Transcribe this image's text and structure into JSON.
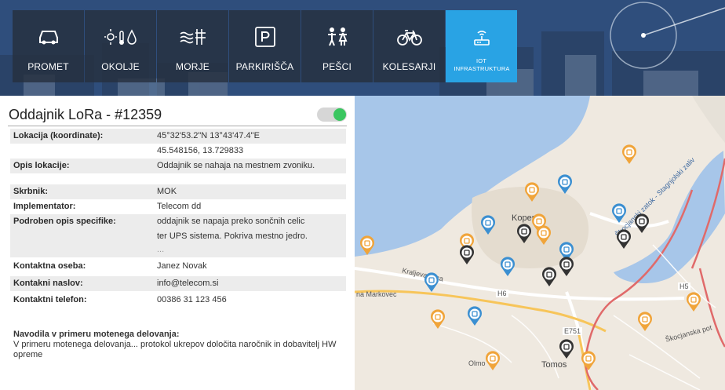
{
  "nav": [
    {
      "label": "PROMET",
      "icon": "car-icon"
    },
    {
      "label": "OKOLJE",
      "icon": "environment-icon"
    },
    {
      "label": "MORJE",
      "icon": "sea-icon"
    },
    {
      "label": "PARKIRIŠČA",
      "icon": "parking-icon"
    },
    {
      "label": "PEŠCI",
      "icon": "pedestrians-icon"
    },
    {
      "label": "KOLESARJI",
      "icon": "bicycle-icon"
    },
    {
      "label": "IOT INFRASTRUKTURA",
      "icon": "iot-router-icon",
      "active": true
    }
  ],
  "panel": {
    "title": "Oddajnik LoRa - #12359",
    "toggle_on": true,
    "location_label": "Lokacija (koordinate):",
    "location_dms": "45°32'53.2\"N 13°43'47.4\"E",
    "location_decimal": "45.548156, 13.729833",
    "description_label": "Opis lokacije:",
    "description_value": "Oddajnik se nahaja na mestnem zvoniku.",
    "custodian_label": "Skrbnik:",
    "custodian_value": "MOK",
    "implementer_label": "Implementator:",
    "implementer_value": "Telecom dd",
    "spec_label": "Podroben opis specifike:",
    "spec_line1": "oddajnik se napaja preko sončnih celic",
    "spec_line2": "ter UPS sistema. Pokriva mestno jedro.",
    "spec_more": "...",
    "contact_person_label": "Kontaktna oseba:",
    "contact_person_value": "Janez Novak",
    "contact_address_label": "Kontakni naslov:",
    "contact_address_value": "info@telecom.si",
    "contact_phone_label": "Kontaktni telefon:",
    "contact_phone_value": "00386 31 123 456",
    "instructions_heading": "Navodila v primeru motenega delovanja:",
    "instructions_text": "V primeru motenega delovanja... protokol ukrepov določita naročnik  in dobavitelj HW opreme"
  },
  "map": {
    "place_koper": "Koper",
    "place_tomos": "Tomos",
    "place_olmo": "Olmo",
    "road_h6": "H6",
    "road_h5": "H5",
    "road_e751": "E751",
    "street_markovec": "na Markovec",
    "street_kraljeva": "Kraljeva ulica",
    "lagoon": "Škocjanski zatok - Stagnjolski zaliv",
    "street_skocjanska": "Škocjanska pot",
    "colors": {
      "sea": "#a7c6e9",
      "land": "#efe9e0",
      "pin_orange": "#f0a43a",
      "pin_blue": "#3b8fd1",
      "pin_black": "#333333"
    }
  }
}
